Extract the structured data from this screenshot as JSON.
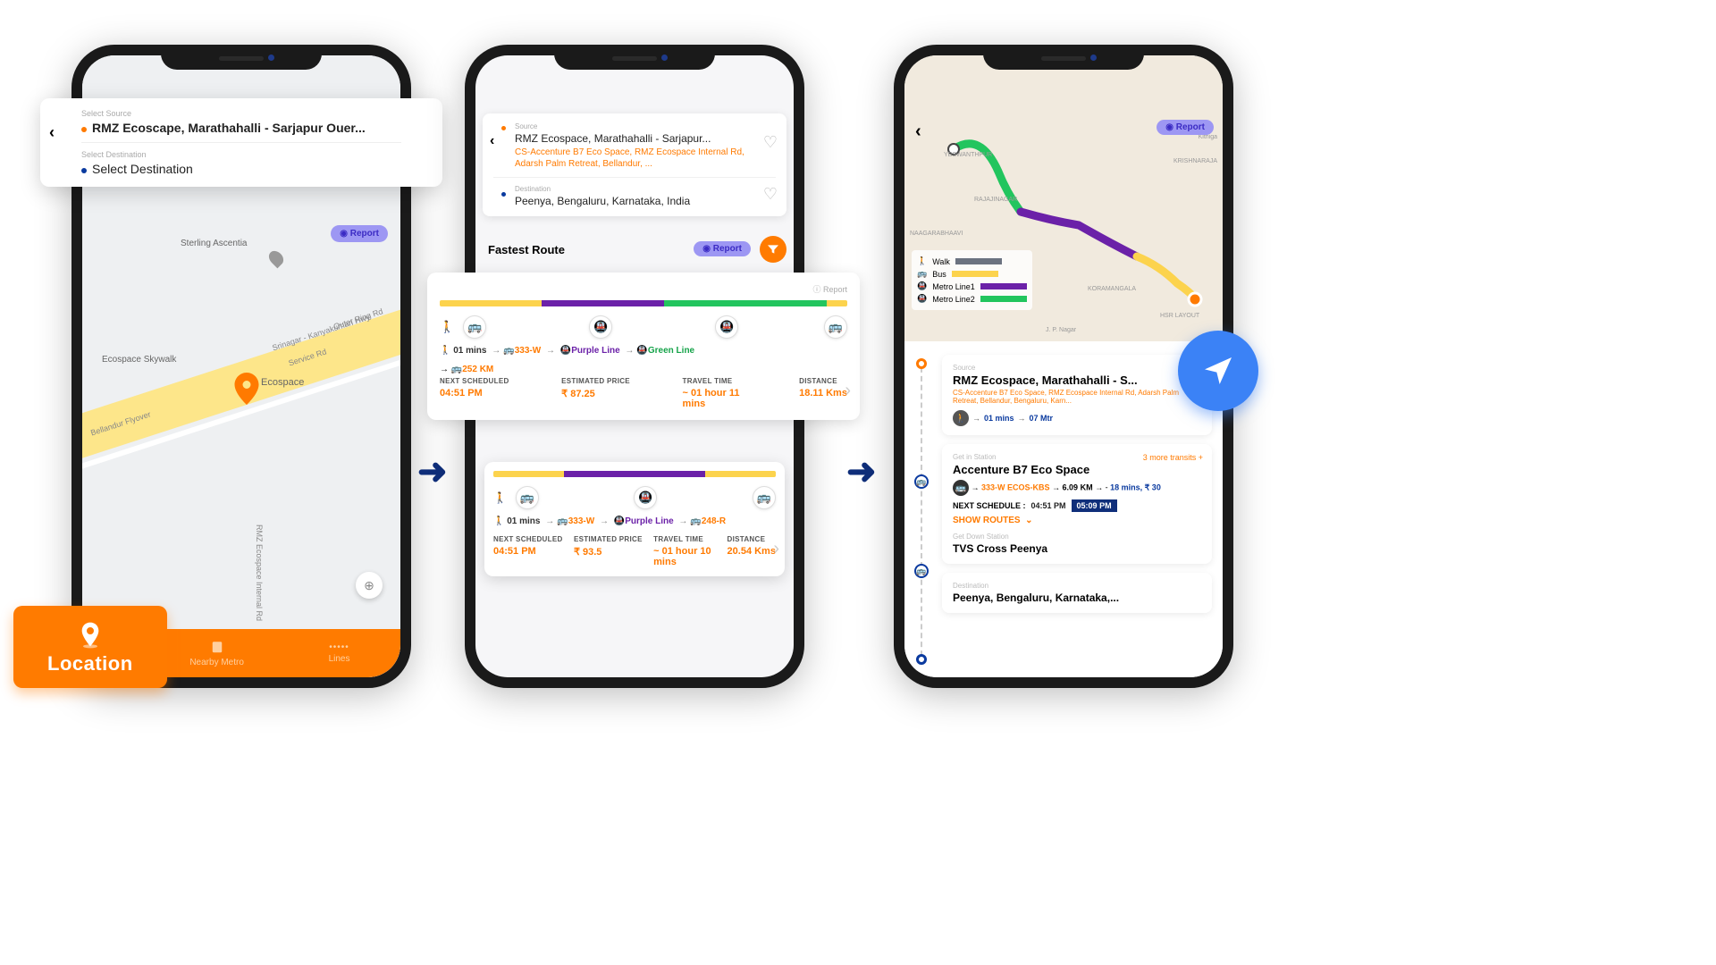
{
  "phone1": {
    "select_source_hint": "Select Source",
    "source_value": "RMZ Ecoscape, Marathahalli - Sarjapur Ouer...",
    "select_dest_hint": "Select Destination",
    "dest_placeholder": "Select Destination",
    "report": "Report",
    "map_labels": {
      "sterling": "Sterling Ascentia",
      "skywalk": "Ecospace Skywalk",
      "ecospace": "Ecospace",
      "road": "Srinagar - Kanyakumari Hwy",
      "outer": "Outer Ring Rd",
      "service": "Service Rd",
      "flyover": "Bellandur Flyover",
      "vert": "RMZ Ecospace Internal Rd"
    },
    "bottom": {
      "nearby": "Nearby Metro",
      "lines": "Lines"
    },
    "location_fab": "Location"
  },
  "phone2": {
    "source_hint": "Source",
    "source_value": "RMZ Ecospace, Marathahalli - Sarjapur...",
    "source_sub": "CS-Accenture B7 Eco Space, RMZ Ecospace Internal Rd, Adarsh Palm Retreat, Bellandur, ...",
    "dest_hint": "Destination",
    "dest_value": "Peenya, Bengaluru, Karnataka, India",
    "fastest": "Fastest Route",
    "report": "Report",
    "route1": {
      "report": "Report",
      "walk": "01 mins",
      "bus": "333-W",
      "purple": "Purple Line",
      "green": "Green Line",
      "km": "252 KM",
      "next_l": "NEXT SCHEDULED",
      "next_v": "04:51 PM",
      "price_l": "ESTIMATED PRICE",
      "price_v": "₹  87.25",
      "travel_l": "TRAVEL TIME",
      "travel_v": "~ 01 hour 11 mins",
      "dist_l": "DISTANCE",
      "dist_v": "18.11 Kms"
    },
    "route2": {
      "walk": "01 mins",
      "bus": "333-W",
      "purple": "Purple Line",
      "bus2": "248-R",
      "next_l": "NEXT SCHEDULED",
      "next_v": "04:51 PM",
      "price_l": "ESTIMATED PRICE",
      "price_v": "₹  93.5",
      "travel_l": "TRAVEL TIME",
      "travel_v": "~ 01 hour 10 mins",
      "dist_l": "DISTANCE",
      "dist_v": "20.54 Kms"
    }
  },
  "phone3": {
    "report": "Report",
    "legend": {
      "walk": "Walk",
      "bus": "Bus",
      "m1": "Metro Line1",
      "m2": "Metro Line2"
    },
    "map_labels": {
      "yesw": "YESWANTHPUR",
      "rajaji": "RAJAJINAGAR",
      "naag": "NAAGARABHAAVI",
      "kora": "KORAMANGALA",
      "hsr": "HSR LAYOUT",
      "jp": "J. P. Nagar",
      "krish": "KRISHNARAJA",
      "kith": "Kithiga"
    },
    "source_hint": "Source",
    "source_value": "RMZ Ecospace, Marathahalli - S...",
    "source_sub": "CS-Accenture B7 Eco Space, RMZ Ecospace Internal Rd, Adarsh Palm Retreat, Bellandur, Bengaluru, Karn...",
    "walk_time": "01 mins",
    "walk_dist": "07 Mtr",
    "station_hint": "Get in Station",
    "station_name": "Accenture B7 Eco Space",
    "more_transits": "3 more transits +",
    "bus_route": "333-W ECOS-KBS",
    "bus_km": "6.09 KM",
    "bus_time": "18 mins, ₹ 30",
    "next_l": "NEXT SCHEDULE :",
    "next_t1": "04:51 PM",
    "next_t2": "05:09 PM",
    "show_routes": "SHOW ROUTES",
    "getdown_hint": "Get Down Station",
    "getdown_name": "TVS Cross Peenya",
    "dest_hint": "Destination",
    "dest_value": "Peenya, Bengaluru, Karnataka,..."
  }
}
